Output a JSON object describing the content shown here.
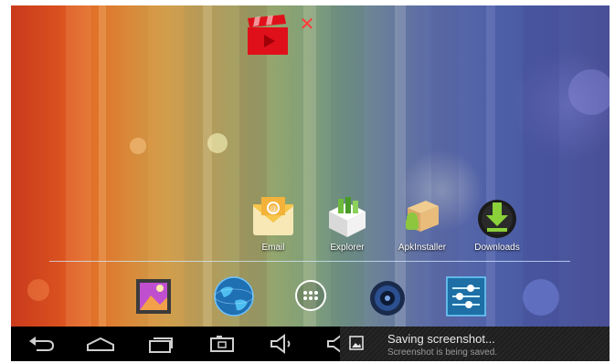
{
  "home_screen": {
    "shortcuts": [
      {
        "label": "Email",
        "icon": "email-icon"
      },
      {
        "label": "Explorer",
        "icon": "explorer-icon"
      },
      {
        "label": "ApkInstaller",
        "icon": "apk-installer-icon"
      },
      {
        "label": "Downloads",
        "icon": "downloads-icon"
      }
    ],
    "widget": {
      "icon": "video-clapper-icon",
      "remove_icon": "close-icon"
    }
  },
  "dock": {
    "items": [
      {
        "icon": "gallery-icon"
      },
      {
        "icon": "browser-globe-icon"
      },
      {
        "icon": "app-drawer-icon"
      },
      {
        "icon": "music-speaker-icon"
      },
      {
        "icon": "settings-sliders-icon"
      }
    ]
  },
  "navigation_bar": {
    "buttons": [
      {
        "icon": "back-icon"
      },
      {
        "icon": "home-icon"
      },
      {
        "icon": "recent-apps-icon"
      },
      {
        "icon": "screenshot-camera-icon"
      },
      {
        "icon": "volume-down-icon"
      },
      {
        "icon": "volume-up-icon"
      }
    ]
  },
  "notification": {
    "title": "Saving screenshot...",
    "subtitle": "Screenshot is being saved.",
    "icon": "image-icon"
  },
  "colors": {
    "navbar_bg": "#000000",
    "wallpaper_left": "#c93a1c",
    "wallpaper_right": "#4a4f96",
    "accent_blue": "#33b5e5"
  }
}
